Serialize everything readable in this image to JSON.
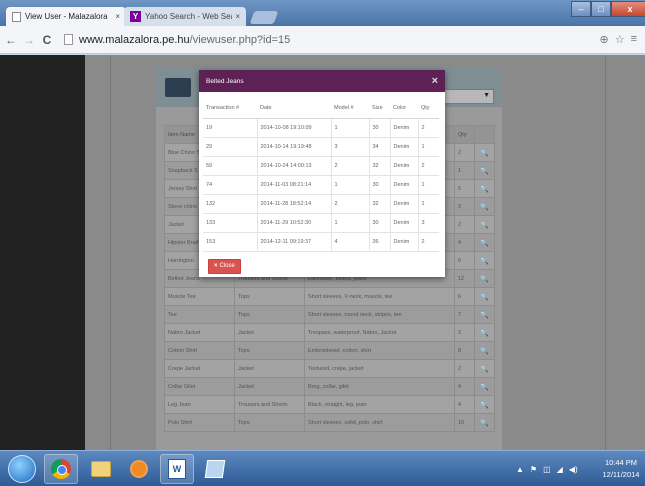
{
  "browser": {
    "tabs": [
      {
        "label": "View User - Malazalora",
        "close": "×"
      },
      {
        "label": "Yahoo Search - Web Searc",
        "close": "×",
        "icon": "Y"
      }
    ],
    "window_controls": {
      "minimize": "–",
      "maximize": "□",
      "close": "x"
    },
    "url_host": "www.malazalora.pe.hu",
    "url_path": "/viewuser.php?id=15",
    "nav": {
      "back": "←",
      "forward": "→",
      "reload": "C"
    },
    "right_icons": {
      "zoom": "⊕",
      "star": "☆",
      "menu": "≡"
    }
  },
  "page": {
    "table_headers": [
      "Item Name",
      "",
      "",
      "Qty",
      ""
    ],
    "rows": [
      {
        "name": "Blue Chino S",
        "category": "",
        "desc": "",
        "qty": "2"
      },
      {
        "name": "Snapback S",
        "category": "",
        "desc": "",
        "qty": "1"
      },
      {
        "name": "Jersey Shirt",
        "category": "",
        "desc": "",
        "qty": "5"
      },
      {
        "name": "Stone chino",
        "category": "",
        "desc": "",
        "qty": "3"
      },
      {
        "name": "Jacket",
        "category": "",
        "desc": "",
        "qty": "2"
      },
      {
        "name": "Hipster Braths",
        "category": "",
        "desc": "",
        "qty": "4"
      },
      {
        "name": "Harrington",
        "category": "",
        "desc": "",
        "qty": "6"
      },
      {
        "name": "Belted Jeans",
        "category": "Trousers and Shorts",
        "desc": "Darkwash, belted, jeans",
        "qty": "12"
      },
      {
        "name": "Muscle Tee",
        "category": "Tops",
        "desc": "Short sleeves, V-neck, muscle, tee",
        "qty": "6"
      },
      {
        "name": "Tee",
        "category": "Tops",
        "desc": "Short sleeves, round neck, stripes, tee",
        "qty": "7"
      },
      {
        "name": "Nabro Jacket",
        "category": "Jacket",
        "desc": "Trespass, waterproof, Nabro, Jacket",
        "qty": "2"
      },
      {
        "name": "Cotton Shirt",
        "category": "Tops",
        "desc": "Embroidered, cotton, shirt",
        "qty": "8"
      },
      {
        "name": "Crepe Jacket",
        "category": "Jacket",
        "desc": "Textured, crepe, jacket",
        "qty": "2"
      },
      {
        "name": "Collar Gilet",
        "category": "Jacket",
        "desc": "Borg, collar, gilet",
        "qty": "4"
      },
      {
        "name": "Leg Jean",
        "category": "Trousers and Shorts",
        "desc": "Black, straight, leg, jean",
        "qty": "4"
      },
      {
        "name": "Polo Shirt",
        "category": "Tops",
        "desc": "Short sleeves, solid, polo, shirt",
        "qty": "10"
      }
    ],
    "view_icon": "🔍"
  },
  "modal": {
    "title": "Belted Jeans",
    "close_x": "×",
    "headers": [
      "Transaction #",
      "Date",
      "Model #",
      "Size",
      "Color",
      "Qty"
    ],
    "rows": [
      [
        "19",
        "2014-10-08 19:10:09",
        "1",
        "30",
        "Denim",
        "2"
      ],
      [
        "29",
        "2014-10-14 19:19:48",
        "3",
        "34",
        "Denim",
        "1"
      ],
      [
        "59",
        "2014-10-24 14:00:13",
        "2",
        "32",
        "Denim",
        "2"
      ],
      [
        "74",
        "2014-11-03 08:21:14",
        "1",
        "30",
        "Denim",
        "1"
      ],
      [
        "132",
        "2014-11-28 18:52:14",
        "2",
        "32",
        "Denim",
        "1"
      ],
      [
        "133",
        "2014-11-29 10:52:30",
        "1",
        "30",
        "Denim",
        "3"
      ],
      [
        "153",
        "2014-12-11 09:19:37",
        "4",
        "36",
        "Denim",
        "2"
      ]
    ],
    "close_button": "Close",
    "close_button_icon": "×"
  },
  "taskbar": {
    "word_icon": "W",
    "time": "10:44 PM",
    "date": "12/11/2014",
    "tray": {
      "arrow": "▲",
      "flag": "⚑",
      "network": "◫",
      "signal": "◢",
      "volume": "◀)"
    }
  }
}
